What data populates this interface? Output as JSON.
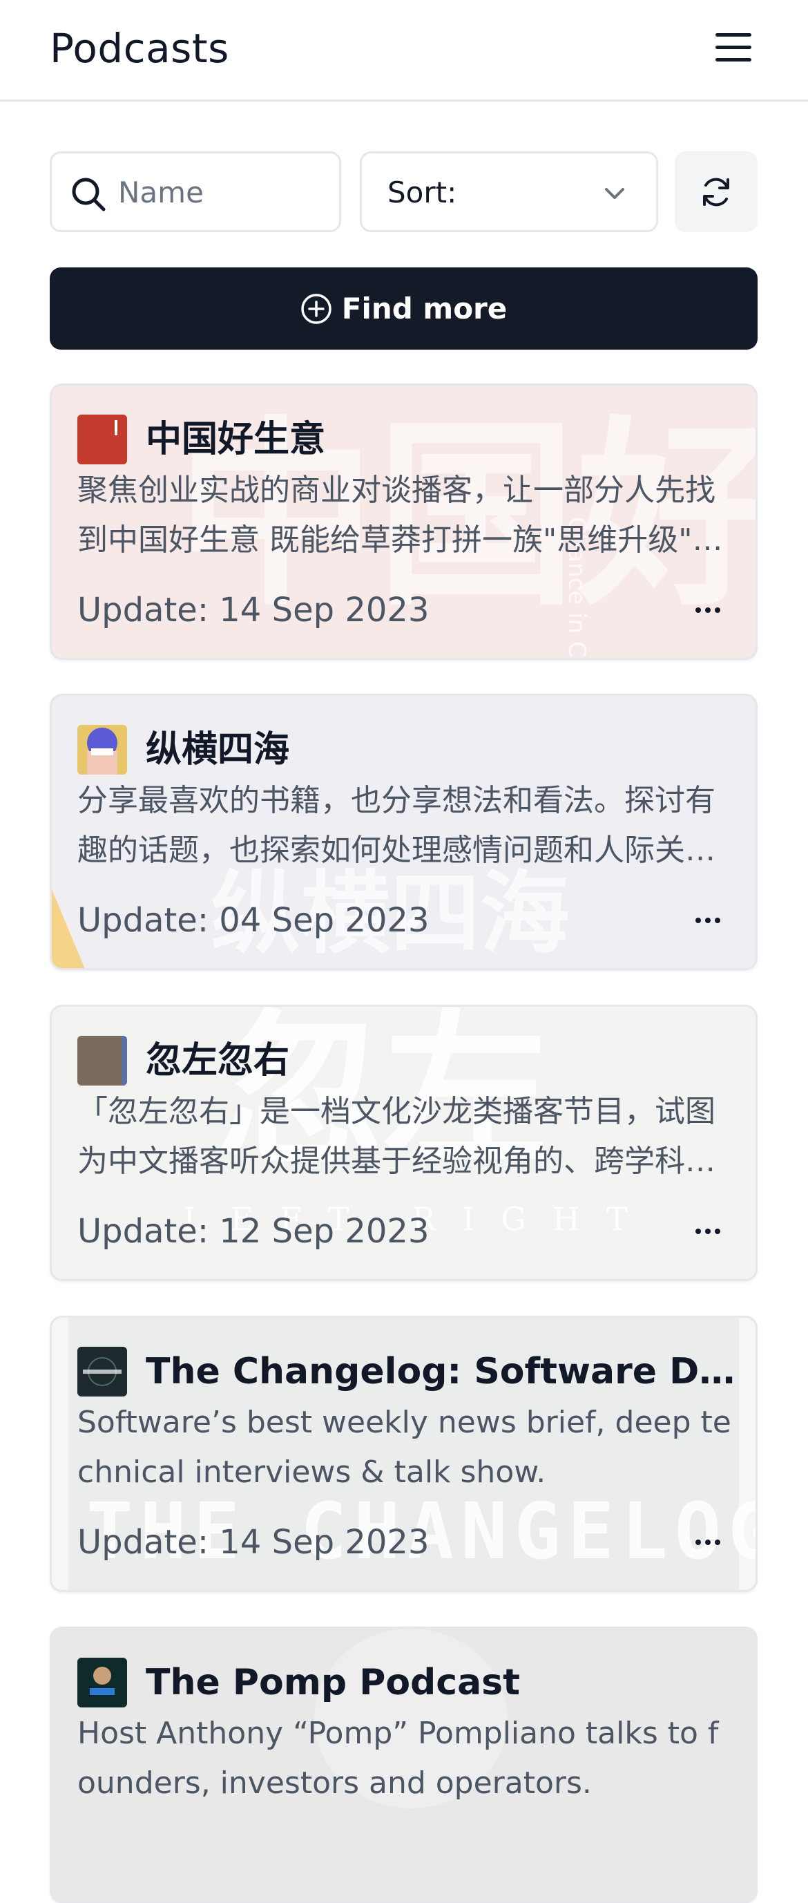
{
  "header": {
    "title": "Podcasts"
  },
  "search": {
    "placeholder": "Name",
    "value": ""
  },
  "sort": {
    "label": "Sort:"
  },
  "find_more": {
    "label": "Find more"
  },
  "podcasts": [
    {
      "title": "中国好生意",
      "description": "聚焦创业实战的商业对谈播客，让一部分人先找到中国好生意 既能给草莽打拼一族\"思维升级\"，也能给创业者带来实战启发。",
      "updated": "Update: 14 Sep 2023",
      "icon_text": "中国好生意",
      "bg_text": "中国好生意",
      "bg_vertical": "Chance in China"
    },
    {
      "title": "纵横四海",
      "description": "分享最喜欢的书籍，也分享想法和看法。探讨有趣的话题，也探索如何处理感情问题和人际关系。",
      "updated": "Update: 04 Sep 2023",
      "icon_text": "纵横四海",
      "bg_text": "纵横四海"
    },
    {
      "title": "忽左忽右",
      "description": "「忽左忽右」是一档文化沙龙类播客节目，试图为中文播客听众提供基于经验视角的、跨学科的话题讨论。",
      "updated": "Update: 12 Sep 2023",
      "icon_text": "忽左忽右",
      "bg_text": "忽左",
      "bg_sub": "LEFT RIGHT"
    },
    {
      "title": "The Changelog: Software Development, Open Source",
      "description": "Software’s best weekly news brief, deep technical interviews & talk show.",
      "updated": "Update: 14 Sep 2023",
      "icon_text": "THE CHANGELOG",
      "bg_text": "THE CHANGELOG"
    },
    {
      "title": "The Pomp Podcast",
      "description": "Host Anthony “Pomp” Pompliano talks to founders, investors and operators.",
      "updated": "",
      "icon_text": "POMP",
      "bg_text": ""
    }
  ],
  "colors": {
    "primary": "#131a28",
    "border": "#e5e7eb",
    "muted_text": "#4b5563",
    "button_bg": "#f3f4f6"
  },
  "icons": {
    "menu": "hamburger-menu-icon",
    "search": "search-icon",
    "sort": "chevron-down-icon",
    "refresh": "refresh-icon",
    "find_more": "plus-circle-icon",
    "more": "more-horizontal-icon"
  }
}
